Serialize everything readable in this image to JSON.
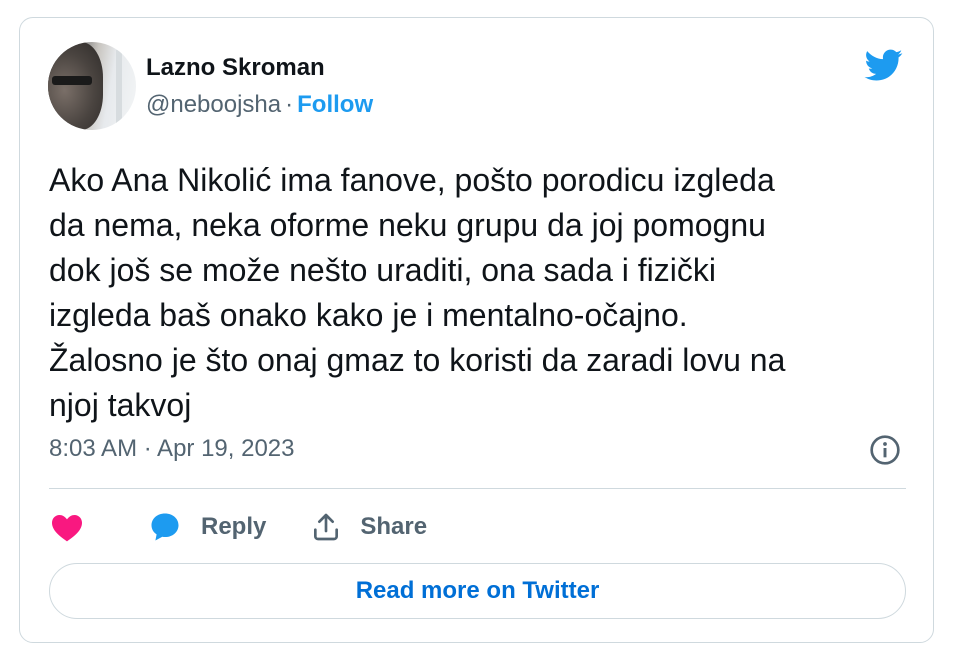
{
  "author": {
    "name": "Lazno Skroman",
    "handle": "@neboojsha",
    "separator": "·",
    "follow_label": "Follow"
  },
  "tweet": {
    "text": "Ako Ana Nikolić ima fanove, pošto porodicu izgleda\nda nema, neka oforme neku grupu da joj pomognu\ndok još se može nešto uraditi, ona sada i fizički\nizgleda baš onako kako je i mentalno-očajno.\nŽalosno je što onaj gmaz to koristi da zaradi lovu na\nnjoj takvoj",
    "timestamp": "8:03 AM · Apr 19, 2023"
  },
  "actions": {
    "reply_label": "Reply",
    "share_label": "Share"
  },
  "read_more_label": "Read more on Twitter",
  "icons": [
    "twitter-bird-icon",
    "info-icon",
    "heart-icon",
    "reply-bubble-icon",
    "share-icon"
  ],
  "colors": {
    "twitter_blue": "#1d9bf0",
    "heart_pink": "#f91880",
    "text_primary": "#0f1419",
    "text_secondary": "#536471",
    "link_blue": "#006fd6",
    "border": "#cfd9de"
  }
}
